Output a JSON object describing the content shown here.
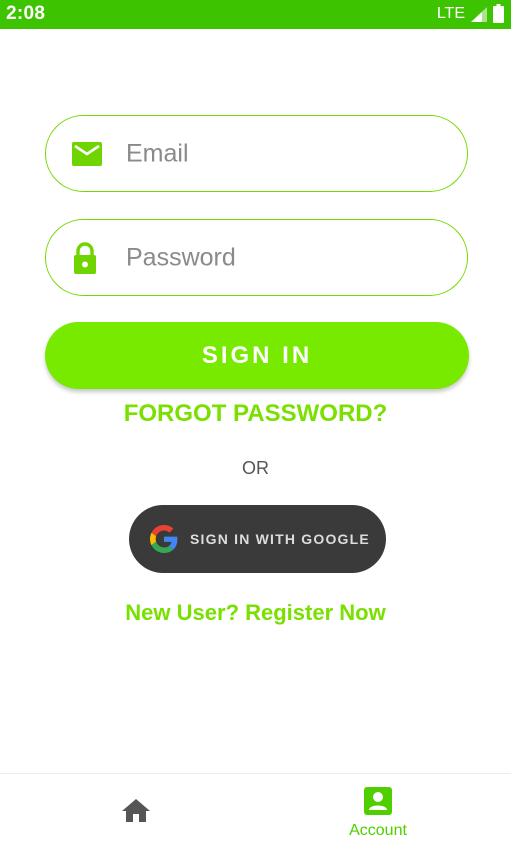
{
  "status_bar": {
    "time": "2:08",
    "network": "LTE",
    "background_color": "#3ec300"
  },
  "form": {
    "email": {
      "placeholder": "Email",
      "value": "",
      "icon": "mail-icon"
    },
    "password": {
      "placeholder": "Password",
      "value": "",
      "icon": "lock-icon"
    },
    "signin_label": "SIGN IN",
    "forgot_label": "FORGOT PASSWORD?",
    "or_label": "OR",
    "google_label": "SIGN IN WITH GOOGLE",
    "register_label": "New User? Register Now"
  },
  "bottom_nav": {
    "items": [
      {
        "icon": "home-icon",
        "label": "",
        "active": false
      },
      {
        "icon": "account-icon",
        "label": "Account",
        "active": true
      }
    ]
  },
  "colors": {
    "accent": "#77ea00",
    "field_border": "#77d800",
    "link": "#79e000",
    "google_button": "#3a3a3a",
    "nav_active": "#4fcf00",
    "nav_inactive": "#555555"
  }
}
